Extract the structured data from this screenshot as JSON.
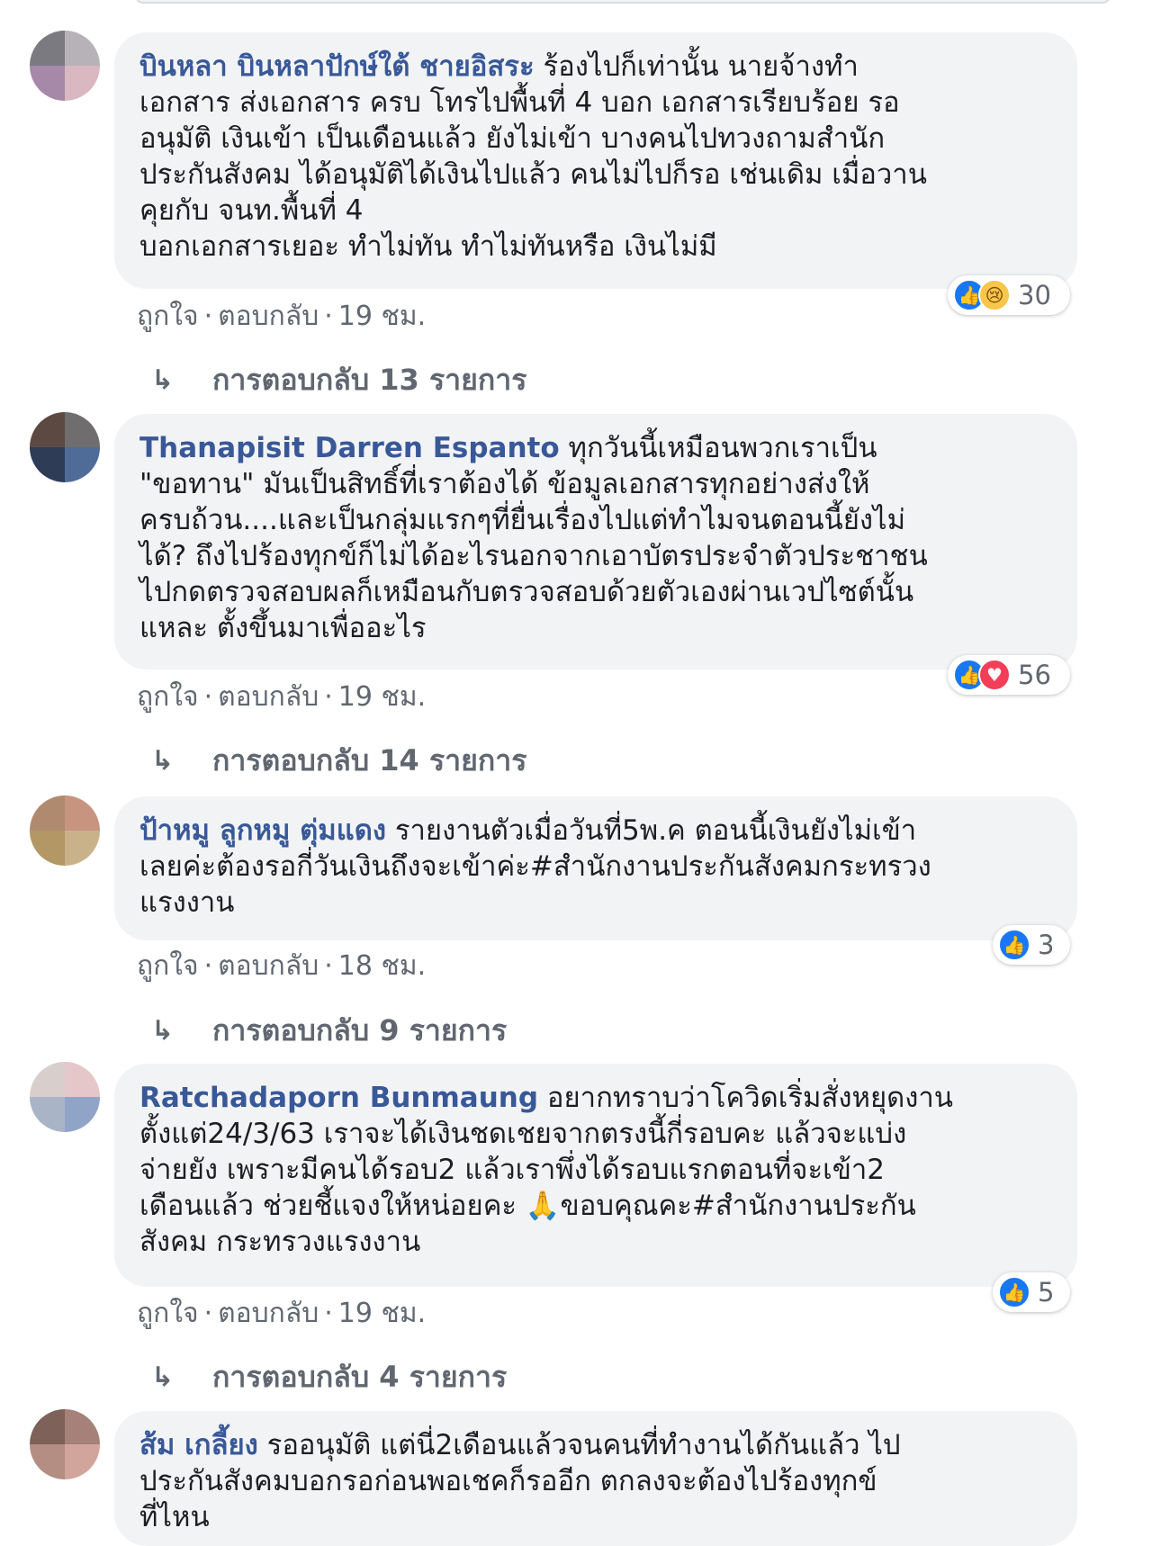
{
  "comments": [
    {
      "author": "บินหลา บินหลาปักษ์ใต้ ชายอิสระ",
      "text": " ร้องไปก็เท่านั้น นายจ้างทำ\nเอกสาร ส่งเอกสาร ครบ โทรไปพื้นที่ 4 บอก เอกสารเรียบร้อย รอ\nอนุมัติ เงินเข้า เป็นเดือนแล้ว ยังไม่เข้า บางคนไปทวงถามสำนัก\nประกันสังคม ได้อนุมัติได้เงินไปแล้ว คนไม่ไปก็รอ เช่นเดิม เมื่อวาน\nคุยกับ จนท.พื้นที่ 4\nบอกเอกสารเยอะ ทำไม่ทัน ทำไม่ทันหรือ เงินไม่มี",
      "reactions": [
        "like-icon",
        "sad-icon"
      ],
      "reaction_count": "30",
      "like_label": "ถูกใจ",
      "reply_label": "ตอบกลับ",
      "time": "19 ชม.",
      "replies_label": "การตอบกลับ 13 รายการ"
    },
    {
      "author": "Thanapisit Darren Espanto",
      "text": " ทุกวันนี้เหมือนพวกเราเป็น\n\"ขอทาน\" มันเป็นสิทธิ์ที่เราต้องได้ ข้อมูลเอกสารทุกอย่างส่งให้\nครบถ้วน....และเป็นกลุ่มแรกๆที่ยื่นเรื่องไปแต่ทำไมจนตอนนี้ยังไม่\nได้? ถึงไปร้องทุกข์ก็ไม่ได้อะไรนอกจากเอาบัตรประจำตัวประชาชน\nไปกดตรวจสอบผลก็เหมือนกับตรวจสอบด้วยตัวเองผ่านเวปไซต์นั้น\nแหละ ตั้งขึ้นมาเพื่ออะไร",
      "reactions": [
        "like-icon",
        "love-icon"
      ],
      "reaction_count": "56",
      "like_label": "ถูกใจ",
      "reply_label": "ตอบกลับ",
      "time": "19 ชม.",
      "replies_label": "การตอบกลับ 14 รายการ"
    },
    {
      "author": "ป้าหมู ลูกหมู ตุ่มแดง",
      "text": " รายงานตัวเมื่อวันที่5พ.ค ตอนนี้เงินยังไม่เข้า\nเลยค่ะต้องรอกี่วันเงินถึงจะเข้าค่ะ#สำนักงานประกันสังคมกระทรวง\nแรงงาน",
      "reactions": [
        "like-icon"
      ],
      "reaction_count": "3",
      "like_label": "ถูกใจ",
      "reply_label": "ตอบกลับ",
      "time": "18 ชม.",
      "replies_label": "การตอบกลับ 9 รายการ"
    },
    {
      "author": "Ratchadaporn Bunmaung",
      "text": " อยากทราบว่าโควิดเริ่มสั่งหยุดงาน\nตั้งแต่24/3/63 เราจะได้เงินชดเชยจากตรงนี้กี่รอบคะ แล้วจะแบ่ง\nจ่ายยัง เพราะมีคนได้รอบ2 แล้วเราพึ่งได้รอบแรกตอนที่จะเข้า2\nเดือนแล้ว ช่วยชี้แจงให้หน่อยคะ 🙏ขอบคุณคะ#สำนักงานประกัน\nสังคม กระทรวงแรงงาน",
      "reactions": [
        "like-icon"
      ],
      "reaction_count": "5",
      "like_label": "ถูกใจ",
      "reply_label": "ตอบกลับ",
      "time": "19 ชม.",
      "replies_label": "การตอบกลับ 4 รายการ"
    },
    {
      "author": "ส้ม เกลี้ยง",
      "text": " รออนุมัติ แต่นี่2เดือนแล้วจนคนที่ทำงานได้กันแล้ว ไป\nประกันสังคมบอกรอก่อนพอเชคก็รออีก ตกลงจะต้องไปร้องทุกข์\nที่ไหน"
    }
  ],
  "colors": {
    "author": "#385898",
    "bubble": "#f2f3f5",
    "meta": "#606770",
    "like": "#1877f2",
    "love": "#f33e58",
    "sad": "#f7c64a"
  }
}
